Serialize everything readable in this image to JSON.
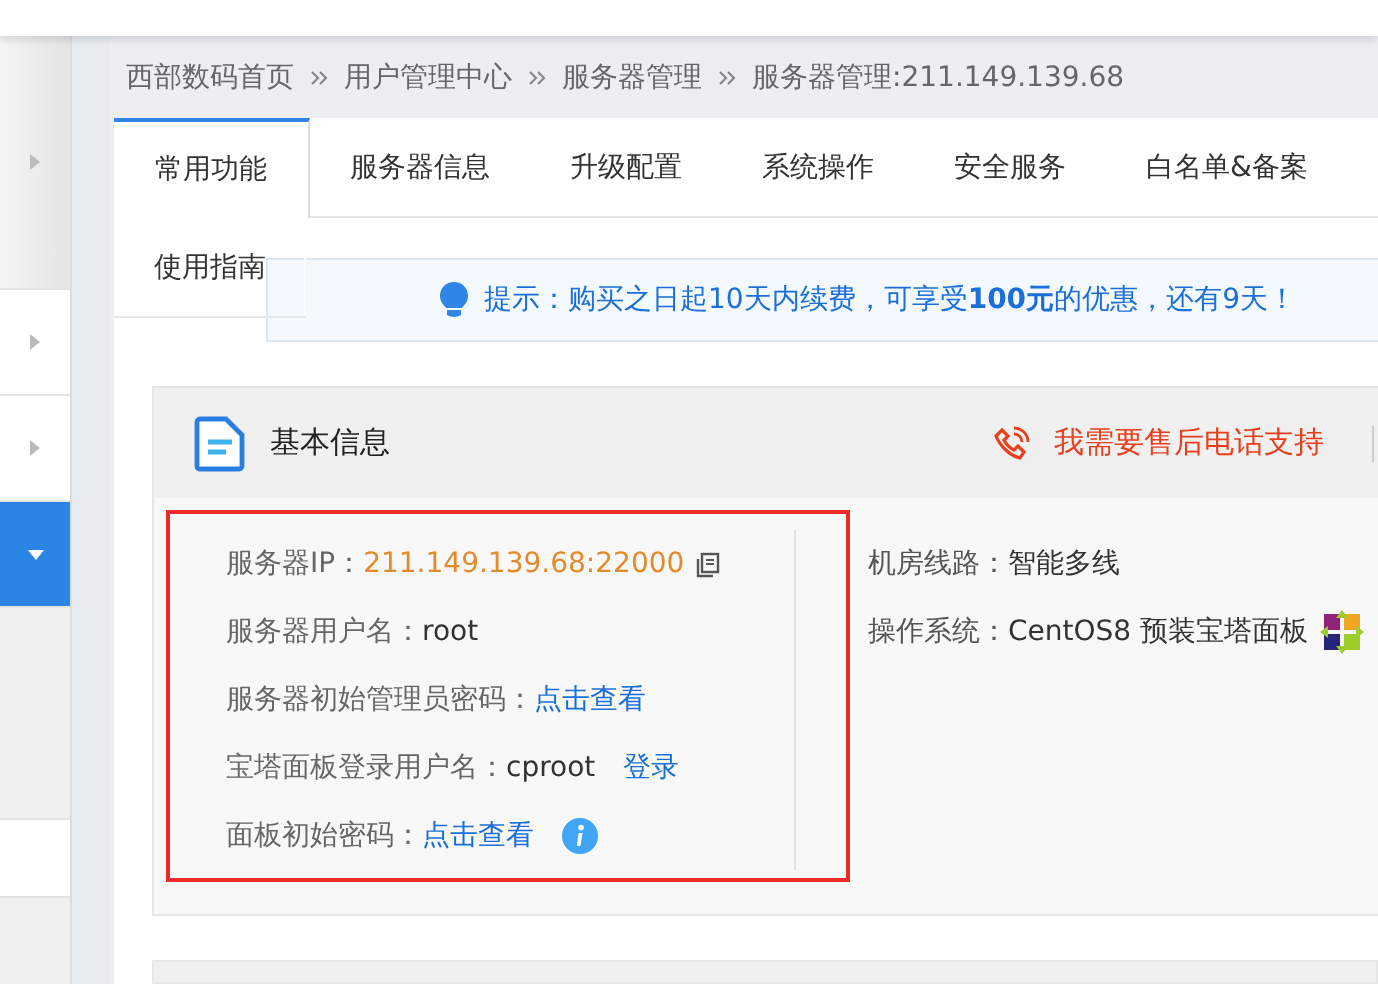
{
  "sidebar": {
    "items": [
      {
        "selected": false,
        "expanded": false
      },
      {
        "selected": false,
        "expanded": false
      },
      {
        "selected": false,
        "expanded": false
      },
      {
        "selected": true,
        "expanded": true
      }
    ]
  },
  "breadcrumb": [
    "西部数码首页",
    "用户管理中心",
    "服务器管理",
    "服务器管理:211.149.139.68"
  ],
  "tabs": [
    {
      "label": "常用功能",
      "selected": true
    },
    {
      "label": "服务器信息",
      "selected": false
    },
    {
      "label": "升级配置",
      "selected": false
    },
    {
      "label": "系统操作",
      "selected": false
    },
    {
      "label": "安全服务",
      "selected": false
    },
    {
      "label": "白名单&备案",
      "selected": false
    },
    {
      "label": "使用指南",
      "selected": false
    }
  ],
  "notice": "提示：购买之日起10天内续费，可享受**100元**的优惠，还有9天！",
  "card": {
    "title": "基本信息",
    "support_link": "我需要售后电话支持",
    "left_fields": [
      {
        "kind": "copy",
        "label": "服务器IP：",
        "value": "211.149.139.68:22000"
      },
      {
        "kind": "text",
        "label": "服务器用户名：",
        "value": "root"
      },
      {
        "kind": "link",
        "label": "服务器初始管理员密码：",
        "link": "点击查看"
      },
      {
        "kind": "text_link",
        "label": "宝塔面板登录用户名：",
        "value": "cproot",
        "link": "登录"
      },
      {
        "kind": "link_info",
        "label": "面板初始密码：",
        "link": "点击查看"
      }
    ],
    "right_fields": [
      {
        "kind": "text",
        "label": "机房线路：",
        "value": "智能多线"
      },
      {
        "kind": "logo",
        "label": "操作系统：",
        "value": "CentOS8 预装宝塔面板"
      }
    ]
  }
}
